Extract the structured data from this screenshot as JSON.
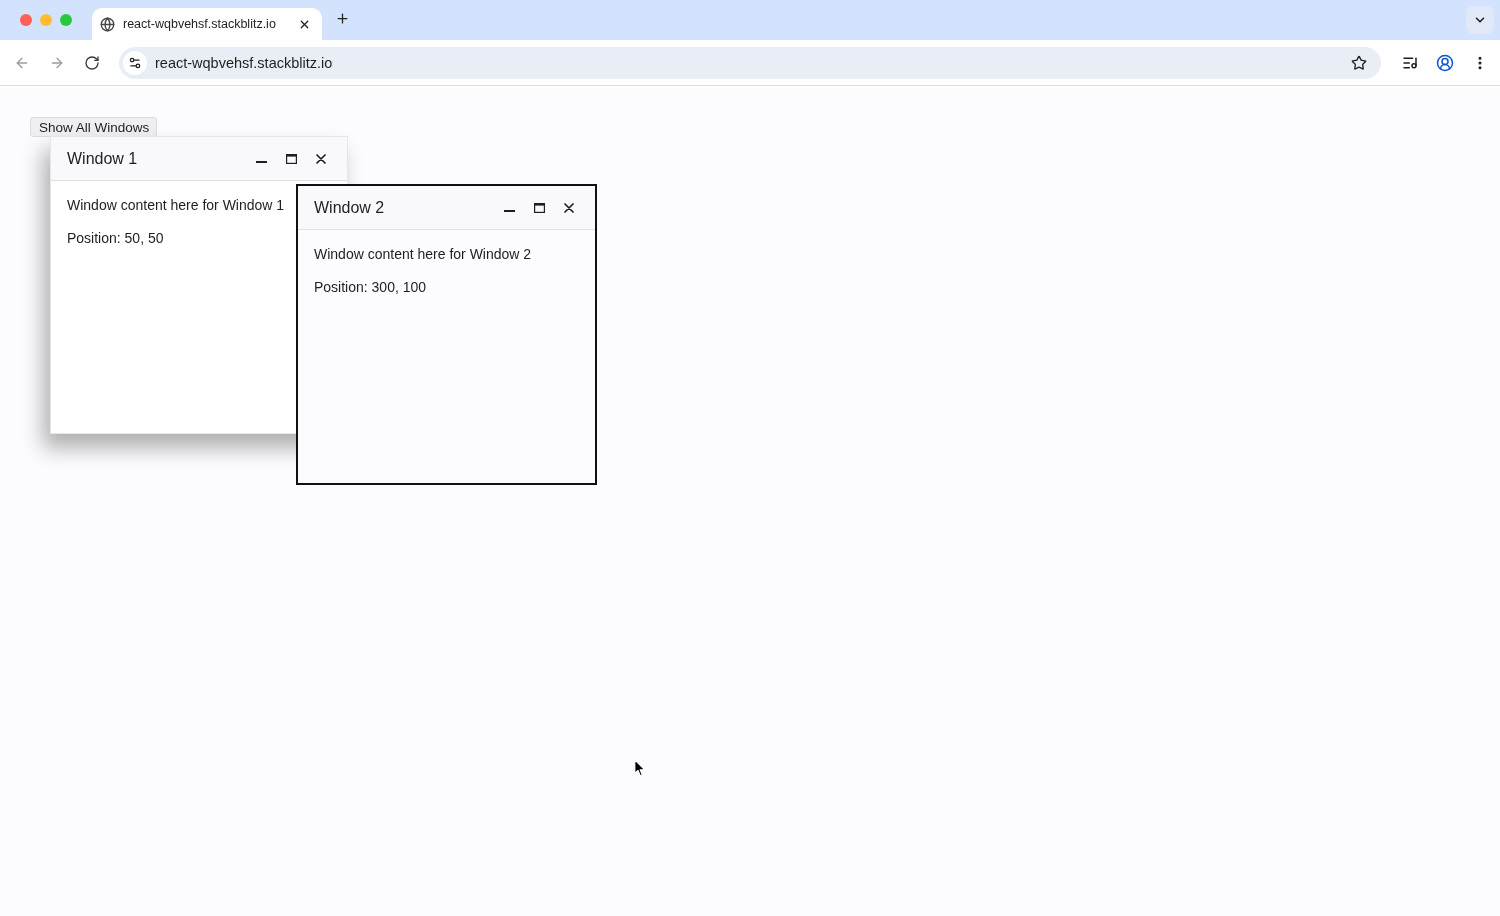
{
  "browser": {
    "tabs": [
      {
        "title": "react-wqbvehsf.stackblitz.io",
        "selected": true
      }
    ],
    "nav_buttons": [
      {
        "kind": "back",
        "disabled": true
      },
      {
        "kind": "forward",
        "disabled": true
      },
      {
        "kind": "reload",
        "disabled": false
      }
    ],
    "address_bar": {
      "url": "react-wqbvehsf.stackblitz.io"
    }
  },
  "page": {
    "show_all_button": {
      "label": "Show All Windows"
    },
    "windows": [
      {
        "title": "Window 1",
        "content": "Window content here for Window 1",
        "position": "Position: 50, 50",
        "selected": false
      },
      {
        "title": "Window 2",
        "content": "Window content here for Window 2",
        "position": "Position: 300, 100",
        "selected": true
      }
    ]
  }
}
